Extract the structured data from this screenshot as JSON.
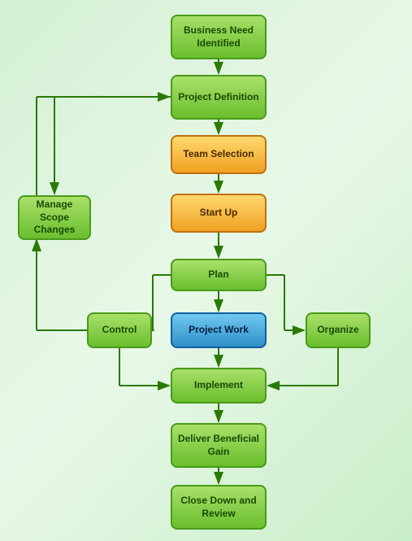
{
  "boxes": {
    "business_need": "Business Need Identified",
    "project_def": "Project Definition",
    "team_selection": "Team Selection",
    "start_up": "Start Up",
    "plan": "Plan",
    "control": "Control",
    "project_work": "Project Work",
    "organize": "Organize",
    "implement": "Implement",
    "deliver": "Deliver Beneficial Gain",
    "close_down": "Close Down and Review",
    "manage_scope": "Manage Scope Changes"
  },
  "colors": {
    "green_accent": "#4a9a1a",
    "orange_accent": "#c07010",
    "blue_accent": "#1060a0",
    "arrow": "#2a7a00"
  }
}
